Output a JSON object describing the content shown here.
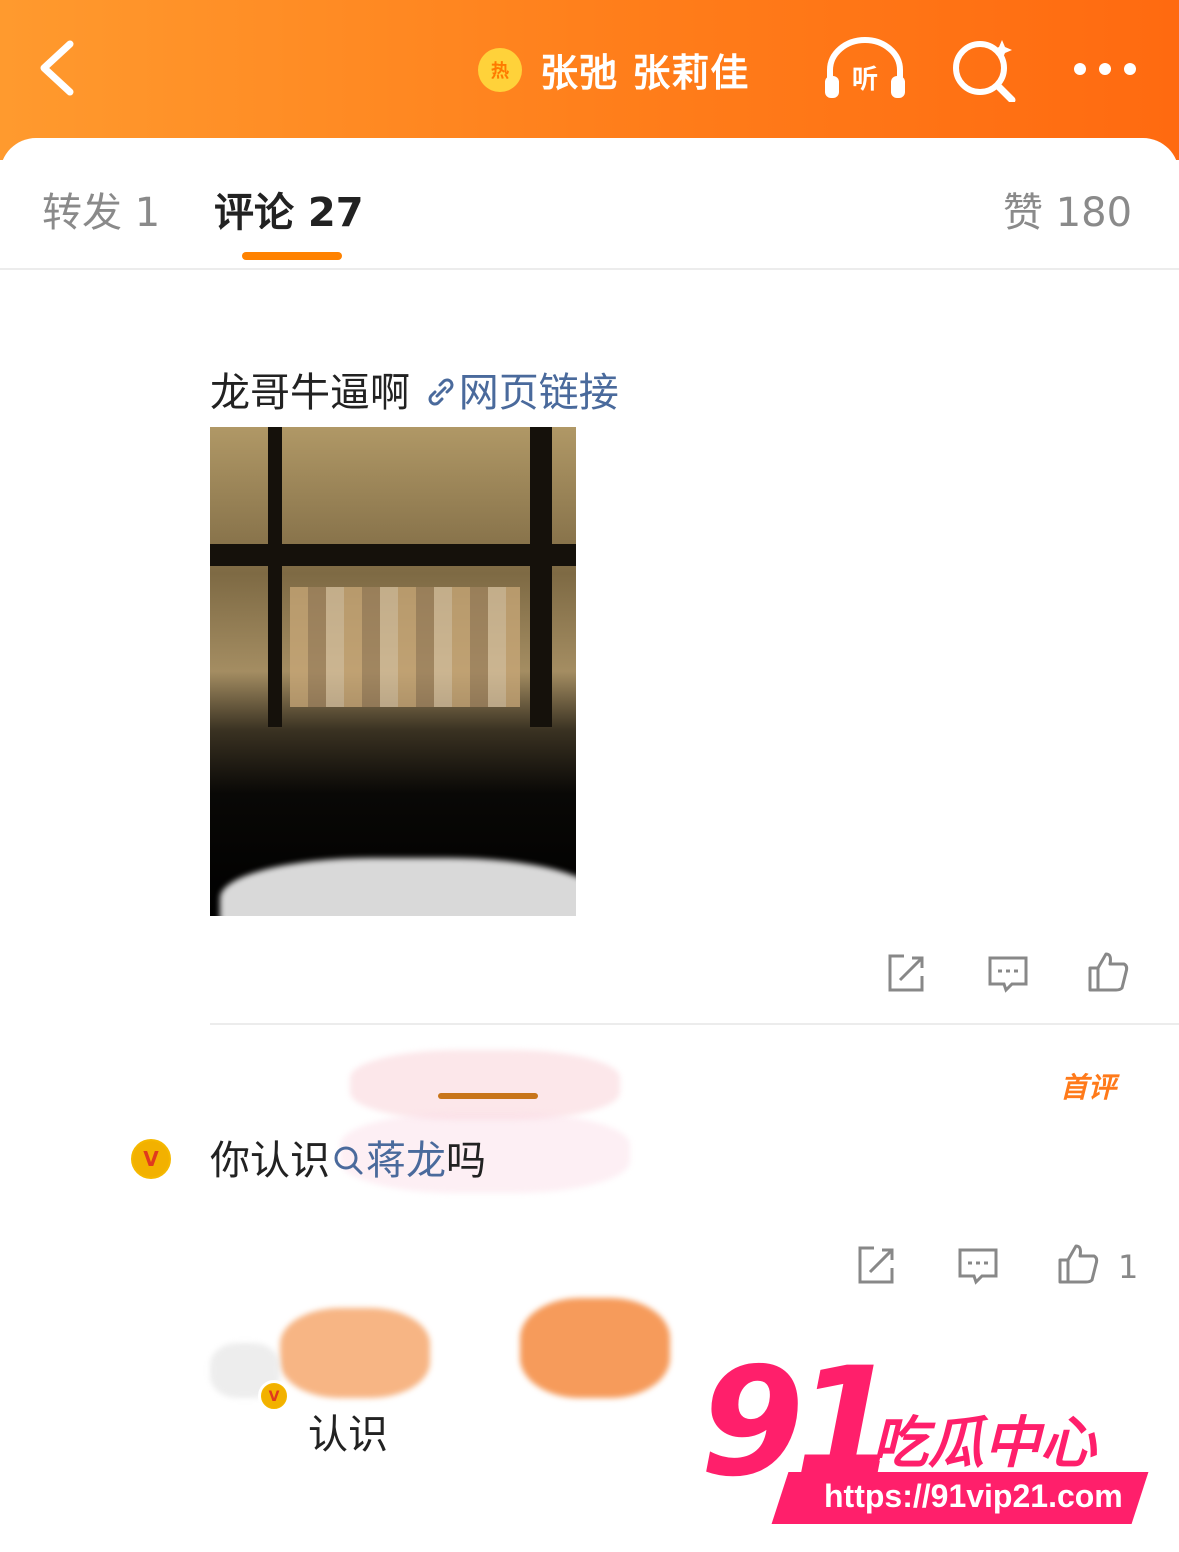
{
  "header": {
    "hot_label": "热",
    "title": "张弛 张莉佳",
    "listen_label": "听"
  },
  "tabs": [
    {
      "label": "转发 1"
    },
    {
      "label": "评论 27"
    },
    {
      "label": "赞 180"
    }
  ],
  "comments": [
    {
      "text": "龙哥牛逼啊",
      "link_text": "网页链接"
    },
    {
      "text_before": "你认识",
      "topic": "蒋龙",
      "text_after": "吗",
      "badge": "首评",
      "likes": "1"
    },
    {
      "text": "认识"
    }
  ],
  "watermark": {
    "big": "91",
    "cn": "吃瓜中心",
    "url": "https://91vip21.com"
  },
  "colors": {
    "brand_orange": "#ff8200",
    "link_blue": "#4a6a9c",
    "watermark_pink": "#ff1f6b"
  }
}
